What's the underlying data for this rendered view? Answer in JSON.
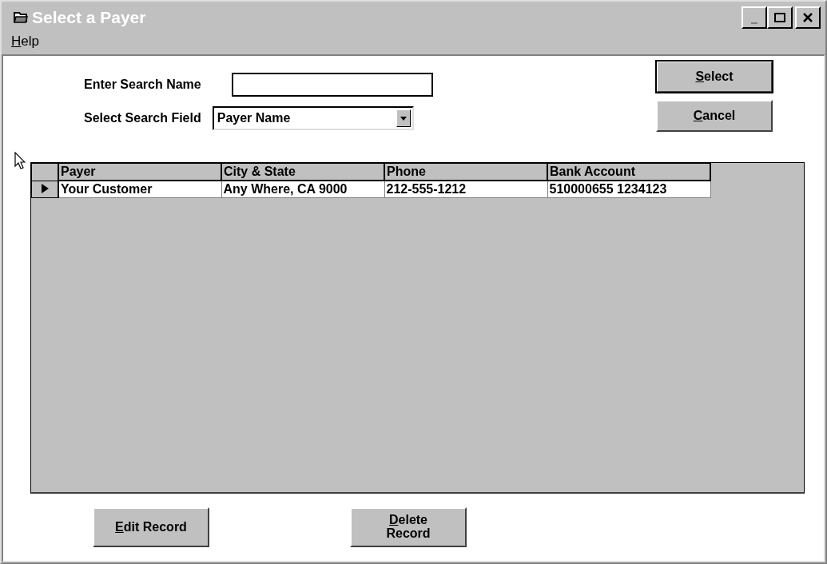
{
  "window": {
    "title": "Select a Payer"
  },
  "menu": [
    {
      "label": "Help",
      "underline_first": true
    }
  ],
  "search_name": {
    "label": "Enter Search Name"
  },
  "search_field": {
    "label": "Select Search Field",
    "value": "Payer Name"
  },
  "side_buttons": [
    {
      "label": "Select",
      "underline_first": true,
      "default": true
    },
    {
      "label": "Cancel",
      "underline_first": true,
      "default": false
    }
  ],
  "table": {
    "columns": [
      "Payer",
      "City & State",
      "Phone",
      "Bank Account"
    ],
    "rows": [
      {
        "current": true,
        "cells": [
          "Your Customer",
          "Any Where, CA 9000",
          "212-555-1212",
          "510000655 1234123"
        ]
      }
    ]
  },
  "bottom_buttons": [
    {
      "label": "Edit Record",
      "underline_first": true
    },
    {
      "label": "Delete\nRecord",
      "underline_first": true
    }
  ]
}
